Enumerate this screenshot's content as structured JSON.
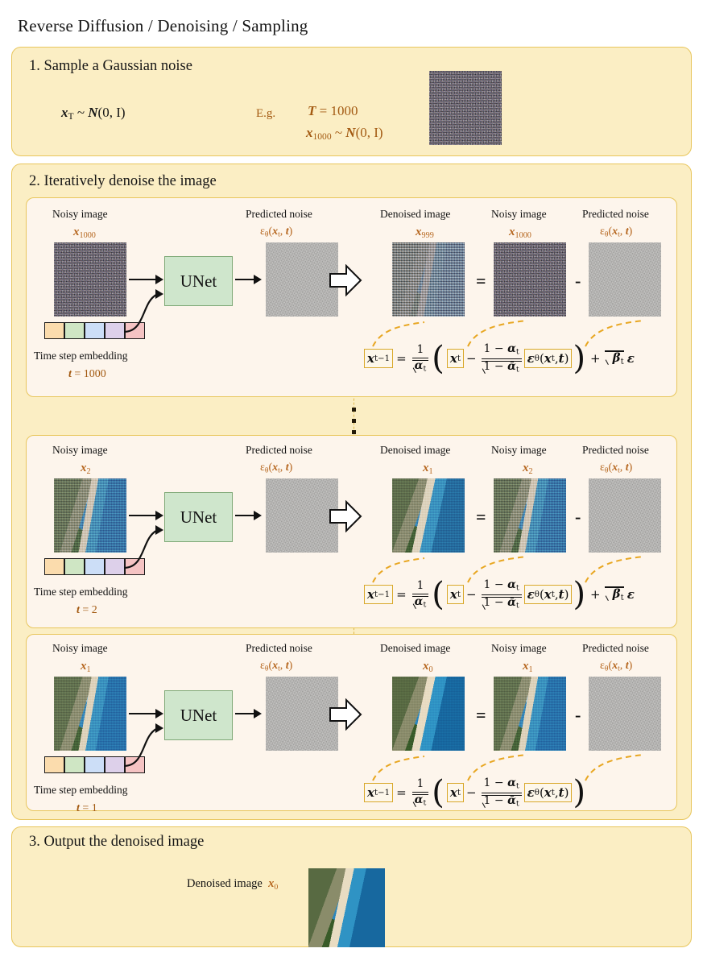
{
  "title": "Reverse Diffusion / Denoising / Sampling",
  "sections": {
    "step1": {
      "heading": "1. Sample a Gaussian noise",
      "distribution": "xT ~ N(0, I)",
      "eg_label": "E.g.",
      "eg_T": "T = 1000",
      "eg_x": "x1000 ~ N(0, I)"
    },
    "step2": {
      "heading": "2. Iteratively denoise the image",
      "ellipsis": "⋮"
    },
    "step3": {
      "heading": "3. Output the denoised image",
      "caption": "Denoised image",
      "caption_sym": "x0"
    }
  },
  "labels": {
    "noisy_image": "Noisy image",
    "predicted_noise": "Predicted noise",
    "denoised_image": "Denoised image",
    "unet": "UNet",
    "time_step_embedding": "Time step embedding",
    "equals": "=",
    "minus": "-"
  },
  "rows": [
    {
      "id": "row-t1000",
      "input_symbol": "x1000",
      "noise_symbol": "εθ(xt, t)",
      "t_value": "t = 1000",
      "denoised_symbol": "x999",
      "noisy_symbol": "x1000",
      "pred_symbol": "εθ(xt, t)",
      "has_noise_term": true
    },
    {
      "id": "row-t2",
      "input_symbol": "x2",
      "noise_symbol": "εθ(xt, t)",
      "t_value": "t = 2",
      "denoised_symbol": "x1",
      "noisy_symbol": "x2",
      "pred_symbol": "εθ(xt, t)",
      "has_noise_term": true
    },
    {
      "id": "row-t1",
      "input_symbol": "x1",
      "noise_symbol": "εθ(xt, t)",
      "t_value": "t = 1",
      "denoised_symbol": "x0",
      "noisy_symbol": "x1",
      "pred_symbol": "εθ(xt, t)",
      "has_noise_term": false
    }
  ],
  "formula": {
    "lhs": "xt-1",
    "eq": "=",
    "coef_num": "1",
    "coef_den": "√αt",
    "open_paren": "(",
    "xt": "xt",
    "minus": "−",
    "frac_num": "1 − αt",
    "frac_den": "√(1 − ᾱt)",
    "eps": "εθ(xt, t)",
    "close_paren": ")",
    "plus": "+",
    "noise_term": "√βt ε"
  },
  "colors": {
    "panel_bg": "#fbeec4",
    "panel_border": "#e8c65c",
    "card_bg": "#fdf5ec",
    "accent_brown": "#b5651d",
    "unet_bg": "#cfe6cc",
    "unet_border": "#7ea876",
    "formula_box_border": "#d9a82a",
    "leader_line": "#e8a723"
  }
}
